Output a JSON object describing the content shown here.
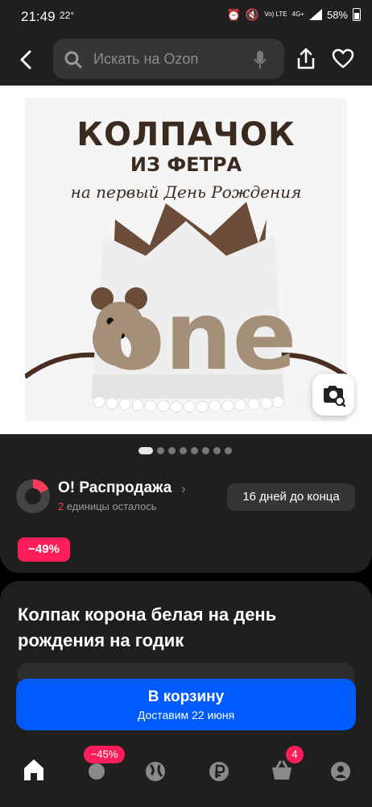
{
  "status_bar": {
    "time": "21:49",
    "temperature": "22°",
    "network_volte": "Vo) LTE",
    "network_type": "4G+",
    "battery": "58%"
  },
  "header": {
    "search_placeholder": "Искать на Ozon"
  },
  "product_image": {
    "line1": "КОЛПАЧОК",
    "line2": "ИЗ ФЕТРА",
    "line3": "на первый День Рождения",
    "crown_text": "one",
    "carousel_dot_count": 8,
    "carousel_active_index": 0
  },
  "promo": {
    "title": "О! Распродажа",
    "remaining_count": "2",
    "remaining_text": "единицы осталось",
    "timer": "16 дней до конца"
  },
  "discount": {
    "label": "−49%"
  },
  "product": {
    "title": "Колпак корона белая на день рождения на годик"
  },
  "cart_button": {
    "label": "В корзину",
    "delivery": "Доставим 22 июня"
  },
  "bottom_nav": {
    "catalog_badge": "−45%",
    "cart_badge": "4"
  },
  "colors": {
    "accent_blue": "#005bff",
    "badge_red": "#ff1e5a",
    "surface": "#1f1f1f"
  }
}
